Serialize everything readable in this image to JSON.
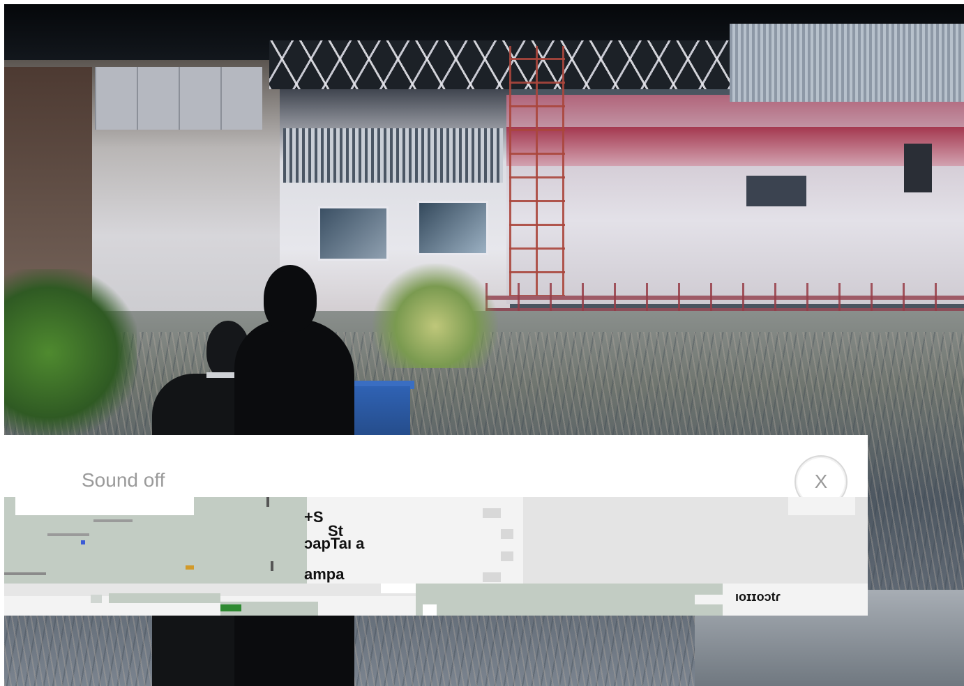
{
  "player": {
    "sound_label": "Sound off",
    "close_label": "X"
  },
  "glitch_fragments": {
    "line1": "+S",
    "line2": "St",
    "line3": "ɔapTaı   a",
    "line4": "ampa",
    "line5": "ıoɪɪoɔtɾ"
  },
  "colors": {
    "overlay_background": "#ffffff",
    "label_gray": "#9a9a9a",
    "close_ring": "#d8d8d8",
    "glitch_sage": "#c2ccc3",
    "glitch_light": "#f3f3f3"
  }
}
